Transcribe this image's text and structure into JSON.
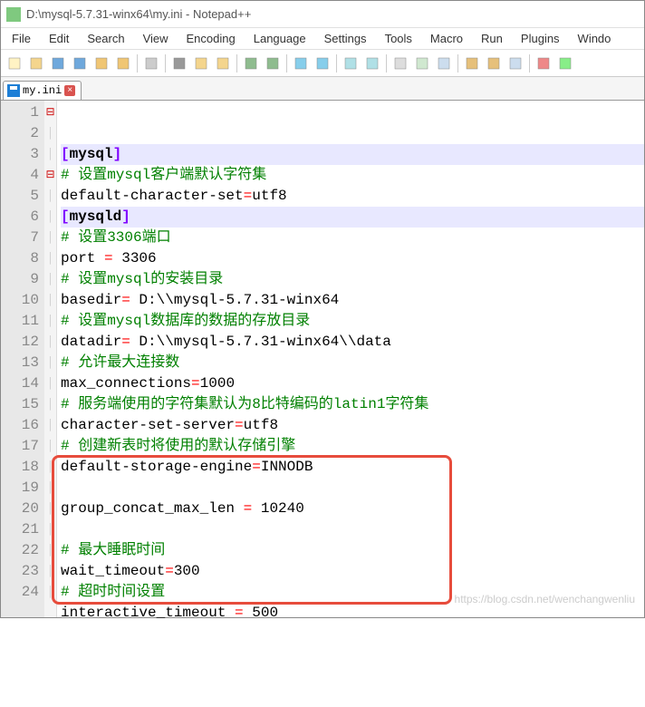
{
  "window": {
    "title": "D:\\mysql-5.7.31-winx64\\my.ini - Notepad++"
  },
  "menu": {
    "items": [
      "File",
      "Edit",
      "Search",
      "View",
      "Encoding",
      "Language",
      "Settings",
      "Tools",
      "Macro",
      "Run",
      "Plugins",
      "Windo"
    ]
  },
  "tab": {
    "name": "my.ini",
    "close": "×"
  },
  "lines": [
    {
      "n": 1,
      "fold": "⊟",
      "html": "<span class='kw-bracket'>[</span><span class='kw-section'>mysql</span><span class='kw-bracket'>]</span>",
      "hl": true
    },
    {
      "n": 2,
      "html": "<span class='comment'># 设置mysql客户端默认字符集</span>"
    },
    {
      "n": 3,
      "html": "<span class='key'>default-character-set</span><span class='op'>=</span><span class='val'>utf8</span>"
    },
    {
      "n": 4,
      "fold": "⊟",
      "html": "<span class='kw-bracket'>[</span><span class='kw-section'>mysqld</span><span class='kw-bracket'>]</span>",
      "hl": true
    },
    {
      "n": 5,
      "html": "<span class='comment'># 设置3306端口</span>"
    },
    {
      "n": 6,
      "html": "<span class='key'>port </span><span class='op'>=</span><span class='val'> 3306</span>"
    },
    {
      "n": 7,
      "html": "<span class='comment'># 设置mysql的安装目录</span>"
    },
    {
      "n": 8,
      "html": "<span class='key'>basedir</span><span class='op'>=</span><span class='val'> D:\\\\mysql-5.7.31-winx64</span>"
    },
    {
      "n": 9,
      "html": "<span class='comment'># 设置mysql数据库的数据的存放目录</span>"
    },
    {
      "n": 10,
      "html": "<span class='key'>datadir</span><span class='op'>=</span><span class='val'> D:\\\\mysql-5.7.31-winx64\\\\data</span>"
    },
    {
      "n": 11,
      "html": "<span class='comment'># 允许最大连接数</span>"
    },
    {
      "n": 12,
      "html": "<span class='key'>max_connections</span><span class='op'>=</span><span class='val'>1000</span>"
    },
    {
      "n": 13,
      "html": "<span class='comment'># 服务端使用的字符集默认为8比特编码的latin1字符集</span>"
    },
    {
      "n": 14,
      "html": "<span class='key'>character-set-server</span><span class='op'>=</span><span class='val'>utf8</span>"
    },
    {
      "n": 15,
      "html": "<span class='comment'># 创建新表时将使用的默认存储引擎</span>"
    },
    {
      "n": 16,
      "html": "<span class='key'>default-storage-engine</span><span class='op'>=</span><span class='val'>INNODB</span>"
    },
    {
      "n": 17,
      "html": ""
    },
    {
      "n": 18,
      "html": "<span class='key'>group_concat_max_len </span><span class='op'>=</span><span class='val'> 10240</span>"
    },
    {
      "n": 19,
      "html": ""
    },
    {
      "n": 20,
      "html": "<span class='comment'># 最大睡眠时间</span>"
    },
    {
      "n": 21,
      "html": "<span class='key'>wait_timeout</span><span class='op'>=</span><span class='val'>300</span>"
    },
    {
      "n": 22,
      "html": "<span class='comment'># 超时时间设置</span>"
    },
    {
      "n": 23,
      "html": "<span class='key'>interactive_timeout </span><span class='op'>=</span><span class='val'> 500</span>"
    },
    {
      "n": 24,
      "html": ""
    }
  ],
  "watermark": "https://blog.csdn.net/wenchangwenliu",
  "toolbar_icons": [
    "new",
    "open",
    "save",
    "saveall",
    "close",
    "closeall",
    "print",
    "cut",
    "copy",
    "paste",
    "undo",
    "redo",
    "find",
    "replace",
    "zoomin",
    "zoomout",
    "sync",
    "wordwrap",
    "allchars",
    "indent1",
    "indent2",
    "fold",
    "record",
    "play"
  ]
}
